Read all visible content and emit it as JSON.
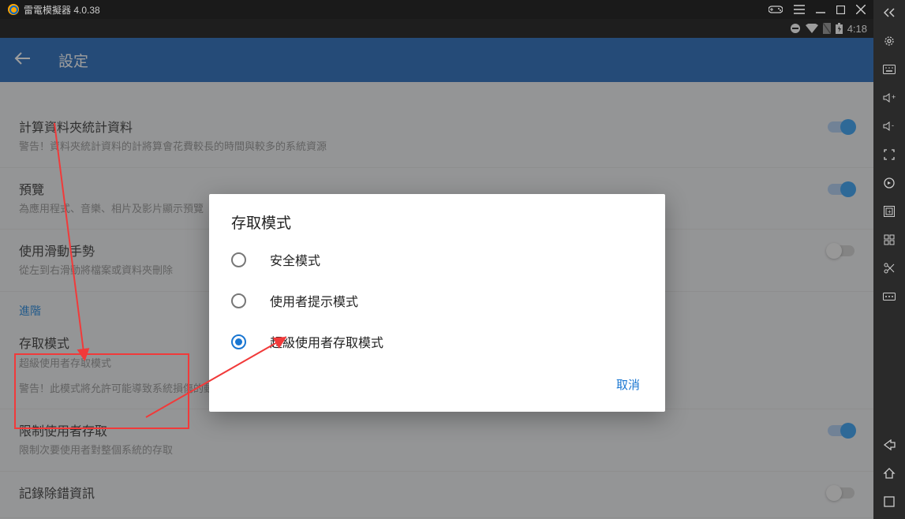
{
  "titlebar": {
    "title": "雷電模擬器 4.0.38"
  },
  "statusbar": {
    "time": "4:18"
  },
  "appbar": {
    "title": "設定"
  },
  "settings": [
    {
      "title": "計算資料夾統計資料",
      "desc": "警告！資料夾統計資料的計將算會花費較長的時間與較多的系統資源",
      "switch": "on"
    },
    {
      "title": "預覽",
      "desc": "為應用程式、音樂、相片及影片顯示預覽",
      "switch": "on"
    },
    {
      "title": "使用滑動手勢",
      "desc": "從左到右滑動將檔案或資料夾刪除",
      "switch": "off"
    }
  ],
  "section_header": "進階",
  "settings2": [
    {
      "title": "存取模式",
      "sub": "超級使用者存取模式",
      "desc": "警告！此模式將允許可能導致系統損傷的動作。您需要自行確認操作是否安全。"
    },
    {
      "title": "限制使用者存取",
      "desc": "限制次要使用者對整個系統的存取",
      "switch": "on"
    },
    {
      "title": "記錄除錯資訊",
      "desc": "",
      "switch": "off"
    }
  ],
  "dialog": {
    "title": "存取模式",
    "options": [
      "安全模式",
      "使用者提示模式",
      "超級使用者存取模式"
    ],
    "selected": 2,
    "cancel": "取消"
  }
}
